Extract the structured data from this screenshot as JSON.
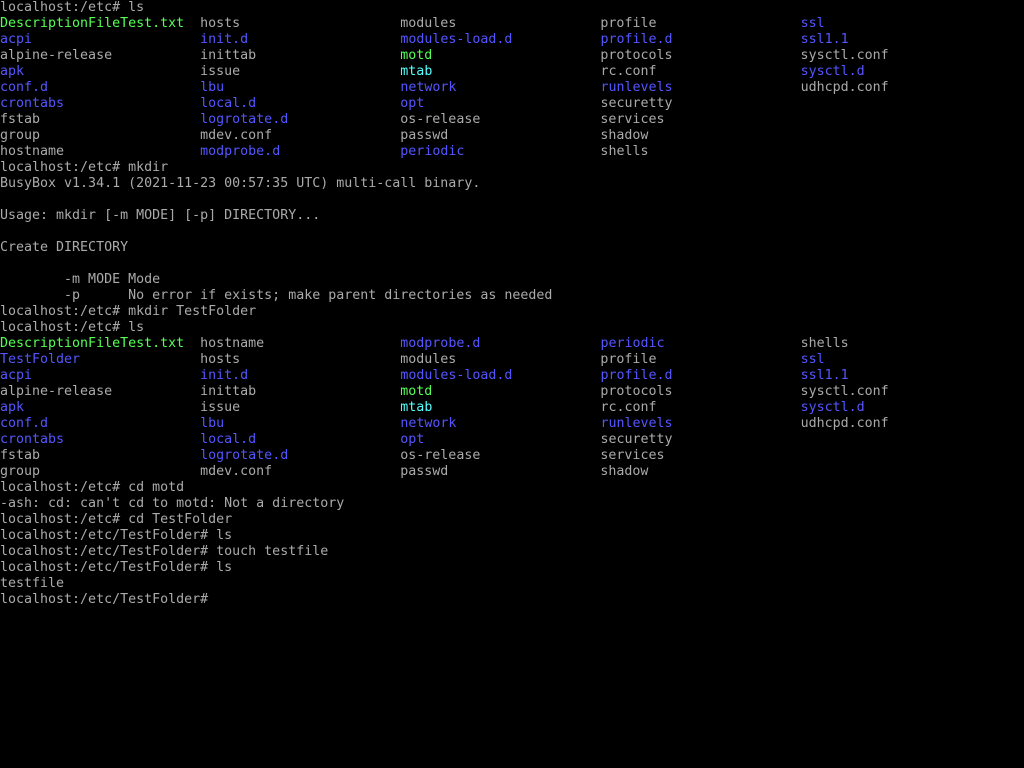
{
  "colors": {
    "background": "#000000",
    "text": "#aaaaaa",
    "executable": "#55ff55",
    "directory": "#5555ff",
    "symlink": "#55ffff"
  },
  "terminal": {
    "lines": [
      [
        {
          "t": "localhost:/etc# ls",
          "c": "def"
        }
      ],
      [
        {
          "t": "DescriptionFileTest.txt",
          "c": "exe"
        },
        {
          "t": "  hosts                    ",
          "c": "def"
        },
        {
          "t": "modules                  ",
          "c": "def"
        },
        {
          "t": "profile                  ",
          "c": "def"
        },
        {
          "t": "ssl",
          "c": "dir"
        }
      ],
      [
        {
          "t": "acpi",
          "c": "dir"
        },
        {
          "t": "                     ",
          "c": "def"
        },
        {
          "t": "init.d",
          "c": "dir"
        },
        {
          "t": "                   ",
          "c": "def"
        },
        {
          "t": "modules-load.d",
          "c": "dir"
        },
        {
          "t": "           ",
          "c": "def"
        },
        {
          "t": "profile.d",
          "c": "dir"
        },
        {
          "t": "                ",
          "c": "def"
        },
        {
          "t": "ssl1.1",
          "c": "dir"
        }
      ],
      [
        {
          "t": "alpine-release           inittab                  ",
          "c": "def"
        },
        {
          "t": "motd",
          "c": "exe"
        },
        {
          "t": "                     protocols                sysctl.conf",
          "c": "def"
        }
      ],
      [
        {
          "t": "apk",
          "c": "dir"
        },
        {
          "t": "                      issue                    ",
          "c": "def"
        },
        {
          "t": "mtab",
          "c": "lnk"
        },
        {
          "t": "                     rc.conf                  ",
          "c": "def"
        },
        {
          "t": "sysctl.d",
          "c": "dir"
        }
      ],
      [
        {
          "t": "conf.d",
          "c": "dir"
        },
        {
          "t": "                   ",
          "c": "def"
        },
        {
          "t": "lbu",
          "c": "dir"
        },
        {
          "t": "                      ",
          "c": "def"
        },
        {
          "t": "network",
          "c": "dir"
        },
        {
          "t": "                  ",
          "c": "def"
        },
        {
          "t": "runlevels",
          "c": "dir"
        },
        {
          "t": "                udhcpd.conf",
          "c": "def"
        }
      ],
      [
        {
          "t": "crontabs",
          "c": "dir"
        },
        {
          "t": "                 ",
          "c": "def"
        },
        {
          "t": "local.d",
          "c": "dir"
        },
        {
          "t": "                  ",
          "c": "def"
        },
        {
          "t": "opt",
          "c": "dir"
        },
        {
          "t": "                      securetty",
          "c": "def"
        }
      ],
      [
        {
          "t": "fstab                    ",
          "c": "def"
        },
        {
          "t": "logrotate.d",
          "c": "dir"
        },
        {
          "t": "              os-release               services",
          "c": "def"
        }
      ],
      [
        {
          "t": "group                    mdev.conf                passwd                   shadow",
          "c": "def"
        }
      ],
      [
        {
          "t": "hostname                 ",
          "c": "def"
        },
        {
          "t": "modprobe.d",
          "c": "dir"
        },
        {
          "t": "               ",
          "c": "def"
        },
        {
          "t": "periodic",
          "c": "dir"
        },
        {
          "t": "                 shells",
          "c": "def"
        }
      ],
      [
        {
          "t": "localhost:/etc# mkdir",
          "c": "def"
        }
      ],
      [
        {
          "t": "BusyBox v1.34.1 (2021-11-23 00:57:35 UTC) multi-call binary.",
          "c": "def"
        }
      ],
      [
        {
          "t": "",
          "c": "def"
        }
      ],
      [
        {
          "t": "Usage: mkdir [-m MODE] [-p] DIRECTORY...",
          "c": "def"
        }
      ],
      [
        {
          "t": "",
          "c": "def"
        }
      ],
      [
        {
          "t": "Create DIRECTORY",
          "c": "def"
        }
      ],
      [
        {
          "t": "",
          "c": "def"
        }
      ],
      [
        {
          "t": "        -m MODE Mode",
          "c": "def"
        }
      ],
      [
        {
          "t": "        -p      No error if exists; make parent directories as needed",
          "c": "def"
        }
      ],
      [
        {
          "t": "localhost:/etc# mkdir TestFolder",
          "c": "def"
        }
      ],
      [
        {
          "t": "localhost:/etc# ls",
          "c": "def"
        }
      ],
      [
        {
          "t": "DescriptionFileTest.txt",
          "c": "exe"
        },
        {
          "t": "  hostname                 ",
          "c": "def"
        },
        {
          "t": "modprobe.d",
          "c": "dir"
        },
        {
          "t": "               ",
          "c": "def"
        },
        {
          "t": "periodic",
          "c": "dir"
        },
        {
          "t": "                 shells",
          "c": "def"
        }
      ],
      [
        {
          "t": "TestFolder",
          "c": "dir"
        },
        {
          "t": "               hosts                    modules                  profile                  ",
          "c": "def"
        },
        {
          "t": "ssl",
          "c": "dir"
        }
      ],
      [
        {
          "t": "acpi",
          "c": "dir"
        },
        {
          "t": "                     ",
          "c": "def"
        },
        {
          "t": "init.d",
          "c": "dir"
        },
        {
          "t": "                   ",
          "c": "def"
        },
        {
          "t": "modules-load.d",
          "c": "dir"
        },
        {
          "t": "           ",
          "c": "def"
        },
        {
          "t": "profile.d",
          "c": "dir"
        },
        {
          "t": "                ",
          "c": "def"
        },
        {
          "t": "ssl1.1",
          "c": "dir"
        }
      ],
      [
        {
          "t": "alpine-release           inittab                  ",
          "c": "def"
        },
        {
          "t": "motd",
          "c": "exe"
        },
        {
          "t": "                     protocols                sysctl.conf",
          "c": "def"
        }
      ],
      [
        {
          "t": "apk",
          "c": "dir"
        },
        {
          "t": "                      issue                    ",
          "c": "def"
        },
        {
          "t": "mtab",
          "c": "lnk"
        },
        {
          "t": "                     rc.conf                  ",
          "c": "def"
        },
        {
          "t": "sysctl.d",
          "c": "dir"
        }
      ],
      [
        {
          "t": "conf.d",
          "c": "dir"
        },
        {
          "t": "                   ",
          "c": "def"
        },
        {
          "t": "lbu",
          "c": "dir"
        },
        {
          "t": "                      ",
          "c": "def"
        },
        {
          "t": "network",
          "c": "dir"
        },
        {
          "t": "                  ",
          "c": "def"
        },
        {
          "t": "runlevels",
          "c": "dir"
        },
        {
          "t": "                udhcpd.conf",
          "c": "def"
        }
      ],
      [
        {
          "t": "crontabs",
          "c": "dir"
        },
        {
          "t": "                 ",
          "c": "def"
        },
        {
          "t": "local.d",
          "c": "dir"
        },
        {
          "t": "                  ",
          "c": "def"
        },
        {
          "t": "opt",
          "c": "dir"
        },
        {
          "t": "                      securetty",
          "c": "def"
        }
      ],
      [
        {
          "t": "fstab                    ",
          "c": "def"
        },
        {
          "t": "logrotate.d",
          "c": "dir"
        },
        {
          "t": "              os-release               services",
          "c": "def"
        }
      ],
      [
        {
          "t": "group                    mdev.conf                passwd                   shadow",
          "c": "def"
        }
      ],
      [
        {
          "t": "localhost:/etc# cd motd",
          "c": "def"
        }
      ],
      [
        {
          "t": "-ash: cd: can't cd to motd: Not a directory",
          "c": "def"
        }
      ],
      [
        {
          "t": "localhost:/etc# cd TestFolder",
          "c": "def"
        }
      ],
      [
        {
          "t": "localhost:/etc/TestFolder# ls",
          "c": "def"
        }
      ],
      [
        {
          "t": "localhost:/etc/TestFolder# touch testfile",
          "c": "def"
        }
      ],
      [
        {
          "t": "localhost:/etc/TestFolder# ls",
          "c": "def"
        }
      ],
      [
        {
          "t": "testfile",
          "c": "def"
        }
      ],
      [
        {
          "t": "localhost:/etc/TestFolder#",
          "c": "def"
        }
      ]
    ]
  }
}
